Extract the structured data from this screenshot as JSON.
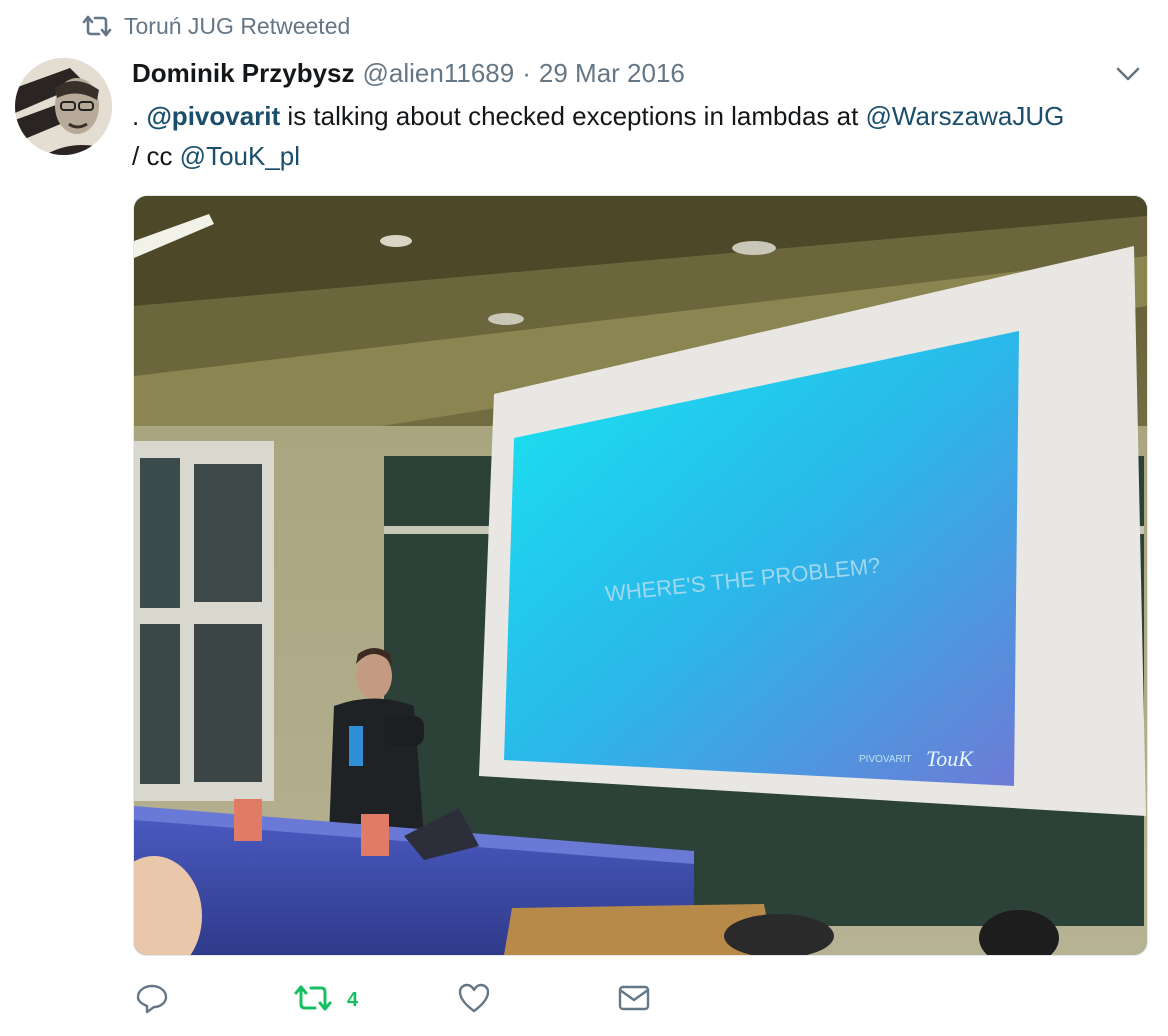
{
  "context": {
    "label": "Toruń JUG Retweeted",
    "icon": "retweet-icon"
  },
  "tweet": {
    "author_name": "Dominik Przybysz",
    "handle": "@alien11689",
    "separator": "·",
    "date": "29 Mar 2016",
    "text_prefix": ". ",
    "mention_1": "@pivovarit",
    "text_middle": " is talking about checked exceptions in lambdas at ",
    "mention_2": "@WarszawaJUG",
    "text_line2": "/ cc ",
    "mention_3": "@TouK_pl"
  },
  "media": {
    "slide_text": "WHERE'S THE PROBLEM?",
    "slide_footer_left": "PIVOVARIT",
    "slide_logo": "TouK"
  },
  "actions": {
    "reply_icon": "reply-icon",
    "retweet_icon": "retweet-icon",
    "retweet_count": "4",
    "like_icon": "heart-icon",
    "dm_icon": "envelope-icon"
  },
  "colors": {
    "text": "#14171a",
    "muted": "#657786",
    "mention": "#1b4e6b",
    "retweet_active": "#17bf63"
  }
}
